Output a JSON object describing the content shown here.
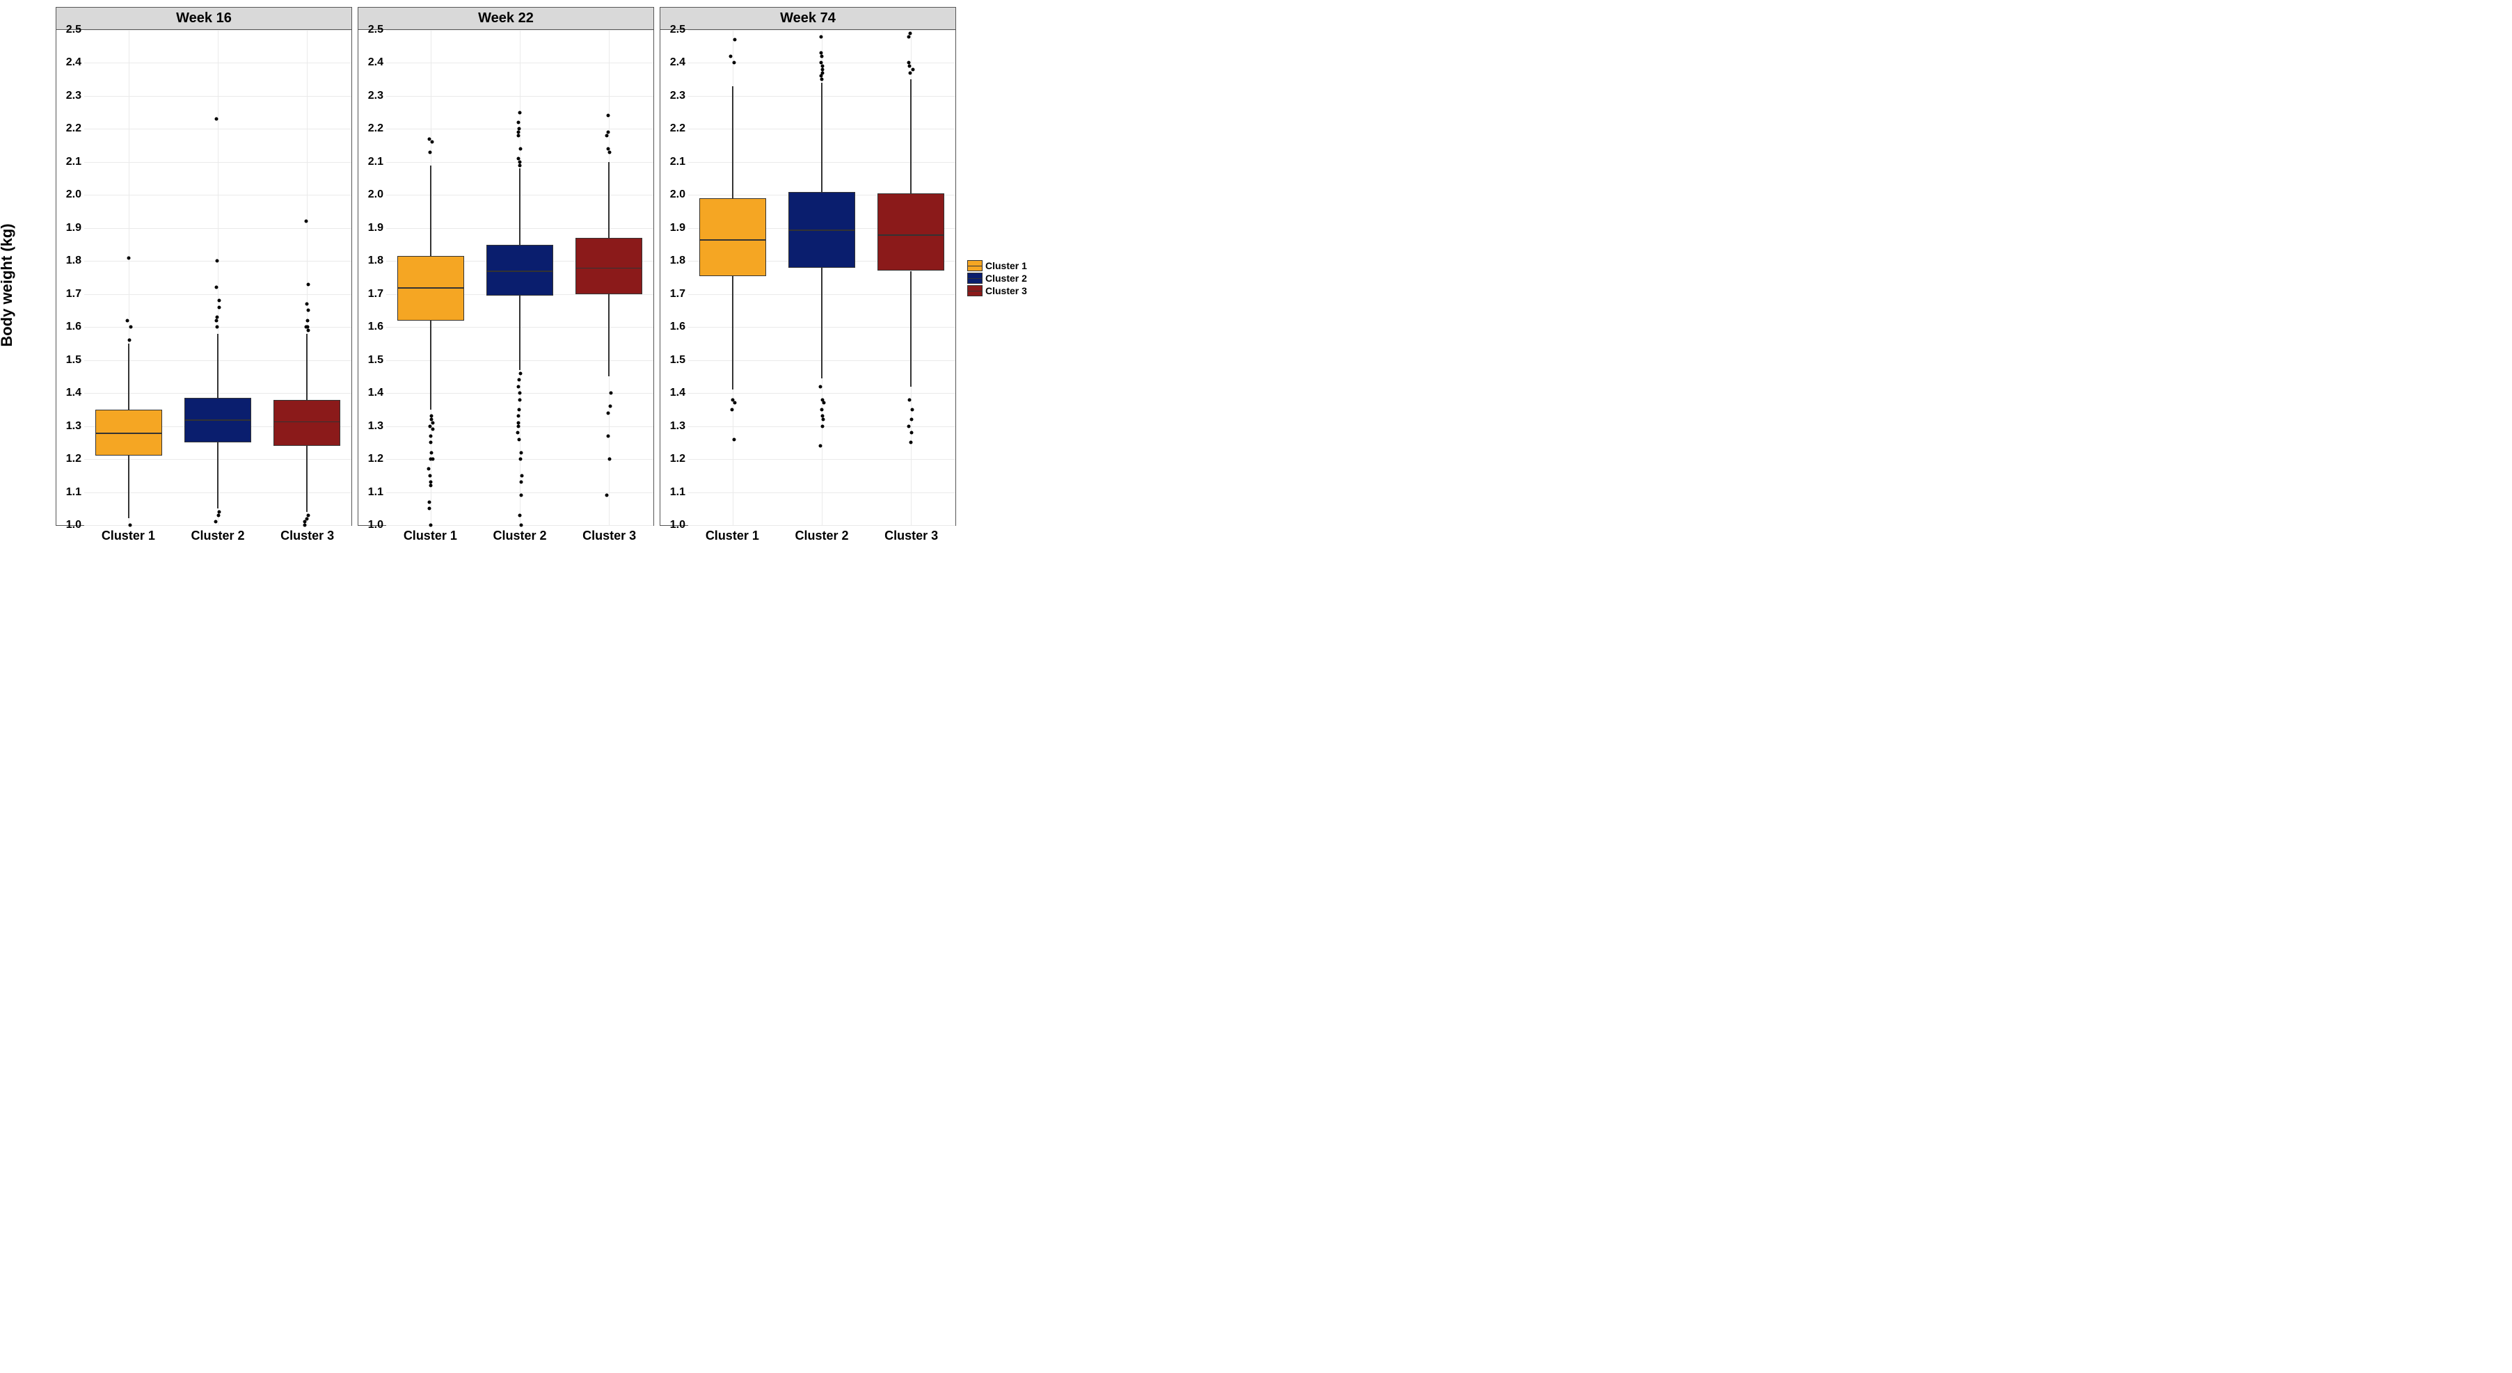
{
  "chart_data": {
    "type": "boxplot",
    "ylabel": "Body weight (kg)",
    "xlabel": "",
    "ylim": [
      1.0,
      2.5
    ],
    "y_ticks": [
      1.0,
      1.1,
      1.2,
      1.3,
      1.4,
      1.5,
      1.6,
      1.7,
      1.8,
      1.9,
      2.0,
      2.1,
      2.2,
      2.3,
      2.4,
      2.5
    ],
    "categories": [
      "Cluster 1",
      "Cluster 2",
      "Cluster 3"
    ],
    "colors": {
      "Cluster 1": "#f5a623",
      "Cluster 2": "#0a1e6e",
      "Cluster 3": "#8b1a1a"
    },
    "legend": [
      "Cluster 1",
      "Cluster 2",
      "Cluster 3"
    ],
    "facets": [
      {
        "title": "Week 16",
        "boxes": [
          {
            "cluster": "Cluster 1",
            "q1": 1.21,
            "median": 1.28,
            "q3": 1.35,
            "low": 1.02,
            "high": 1.55,
            "outliers": [
              1.0,
              1.56,
              1.6,
              1.62,
              1.81
            ]
          },
          {
            "cluster": "Cluster 2",
            "q1": 1.25,
            "median": 1.32,
            "q3": 1.385,
            "low": 1.05,
            "high": 1.58,
            "outliers": [
              1.01,
              1.03,
              1.04,
              1.6,
              1.62,
              1.63,
              1.66,
              1.68,
              1.72,
              1.8,
              2.23
            ]
          },
          {
            "cluster": "Cluster 3",
            "q1": 1.24,
            "median": 1.315,
            "q3": 1.38,
            "low": 1.04,
            "high": 1.58,
            "outliers": [
              1.0,
              1.01,
              1.02,
              1.03,
              1.59,
              1.6,
              1.6,
              1.62,
              1.65,
              1.67,
              1.73,
              1.92
            ]
          }
        ]
      },
      {
        "title": "Week 22",
        "boxes": [
          {
            "cluster": "Cluster 1",
            "q1": 1.62,
            "median": 1.72,
            "q3": 1.815,
            "low": 1.35,
            "high": 2.09,
            "outliers": [
              1.0,
              1.05,
              1.07,
              1.12,
              1.13,
              1.15,
              1.17,
              1.2,
              1.2,
              1.22,
              1.25,
              1.27,
              1.29,
              1.3,
              1.31,
              1.32,
              1.33,
              2.13,
              2.16,
              2.17
            ]
          },
          {
            "cluster": "Cluster 2",
            "q1": 1.695,
            "median": 1.77,
            "q3": 1.85,
            "low": 1.47,
            "high": 2.08,
            "outliers": [
              1.0,
              1.03,
              1.09,
              1.13,
              1.15,
              1.2,
              1.22,
              1.26,
              1.28,
              1.3,
              1.31,
              1.33,
              1.35,
              1.38,
              1.4,
              1.42,
              1.44,
              1.46,
              2.09,
              2.1,
              2.11,
              2.14,
              2.18,
              2.19,
              2.2,
              2.22,
              2.25
            ]
          },
          {
            "cluster": "Cluster 3",
            "q1": 1.7,
            "median": 1.78,
            "q3": 1.87,
            "low": 1.45,
            "high": 2.1,
            "outliers": [
              1.09,
              1.2,
              1.27,
              1.34,
              1.36,
              1.4,
              2.13,
              2.14,
              2.18,
              2.19,
              2.24
            ]
          }
        ]
      },
      {
        "title": "Week 74",
        "boxes": [
          {
            "cluster": "Cluster 1",
            "q1": 1.755,
            "median": 1.865,
            "q3": 1.99,
            "low": 1.41,
            "high": 2.33,
            "outliers": [
              1.26,
              1.35,
              1.37,
              1.38,
              2.4,
              2.42,
              2.47
            ]
          },
          {
            "cluster": "Cluster 2",
            "q1": 1.78,
            "median": 1.895,
            "q3": 2.01,
            "low": 1.445,
            "high": 2.34,
            "outliers": [
              1.24,
              1.3,
              1.32,
              1.33,
              1.35,
              1.37,
              1.38,
              1.42,
              2.35,
              2.36,
              2.37,
              2.38,
              2.39,
              2.4,
              2.42,
              2.43,
              2.48
            ]
          },
          {
            "cluster": "Cluster 3",
            "q1": 1.77,
            "median": 1.88,
            "q3": 2.005,
            "low": 1.42,
            "high": 2.35,
            "outliers": [
              1.25,
              1.28,
              1.3,
              1.32,
              1.35,
              1.38,
              2.37,
              2.38,
              2.39,
              2.4,
              2.48,
              2.49
            ]
          }
        ]
      }
    ]
  }
}
